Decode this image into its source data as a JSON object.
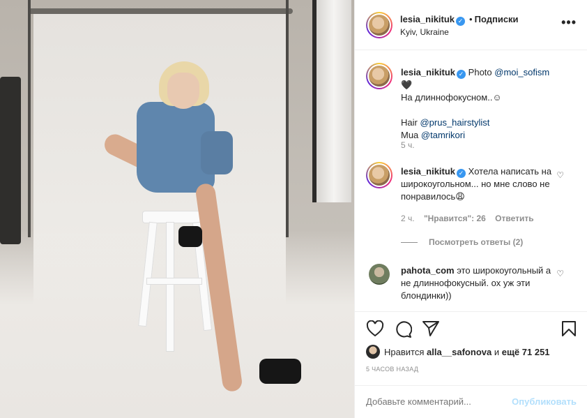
{
  "post": {
    "author": "lesia_nikituk",
    "follow_label": "Подписки",
    "location": "Kyiv, Ukraine",
    "more_label": "•••"
  },
  "caption": {
    "author": "lesia_nikituk",
    "text1": "Photo",
    "mention1": "@moi_sofism",
    "emoji1": "🖤",
    "line2": "На длиннофокусном..☺",
    "hair_label": "Hair",
    "mention2": "@prus_hairstylist",
    "mua_label": "Mua",
    "mention3": "@tamrikori",
    "time": "5 ч."
  },
  "comments": [
    {
      "author": "lesia_nikituk",
      "text": "Хотела написать на широкоугольном... но мне слово не понравилось😩",
      "time": "2 ч.",
      "likes": "\"Нравится\": 26",
      "reply": "Ответить",
      "view_replies": "Посмотреть ответы (2)"
    },
    {
      "author": "pahota_com",
      "text": "это широкоугольный а не длиннофокусный. ох уж эти блондинки))"
    }
  ],
  "actions": {
    "likes_prefix": "Нравится",
    "liker": "alla__safonova",
    "likes_and": "и",
    "likes_rest": "ещё 71 251",
    "time_ago": "5 ЧАСОВ НАЗАД",
    "comment_placeholder": "Добавьте комментарий...",
    "publish_label": "Опубликовать"
  },
  "colors": {
    "link": "#00376b",
    "verified": "#3897f0",
    "publish_disabled": "#b2dffc"
  }
}
